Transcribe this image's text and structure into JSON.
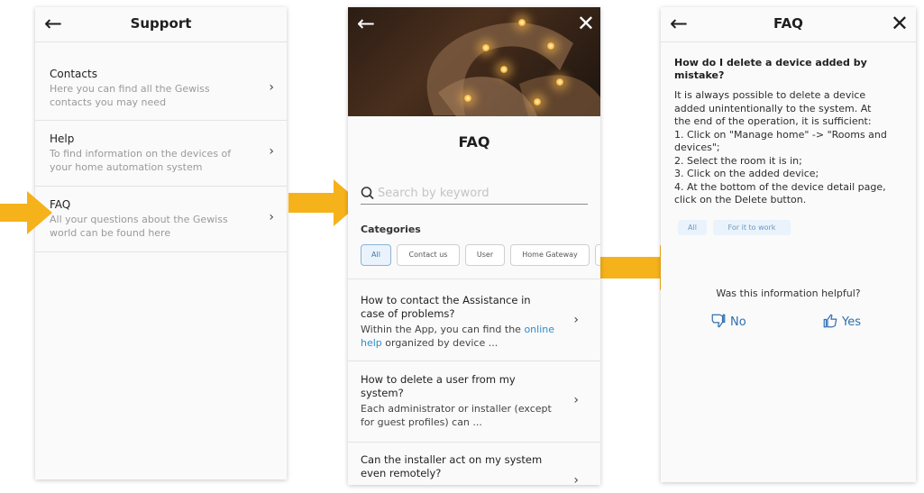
{
  "colors": {
    "accent": "#f5b21b",
    "link": "#2c8ecb",
    "chip_active": "#3b78b5"
  },
  "panel1": {
    "header": {
      "title": "Support",
      "back_icon": "arrow-left-icon"
    },
    "items": [
      {
        "title": "Contacts",
        "desc": "Here you can find all the Gewiss contacts you may need"
      },
      {
        "title": "Help",
        "desc": "To find information on the devices of your home automation system"
      },
      {
        "title": "FAQ",
        "desc": "All your questions about the Gewiss world can be found here"
      }
    ]
  },
  "panel2": {
    "title": "FAQ",
    "search": {
      "placeholder": "Search by keyword"
    },
    "categories_label": "Categories",
    "chips": [
      "All",
      "Contact us",
      "User",
      "Home Gateway"
    ],
    "questions": [
      {
        "title": "How to contact the Assistance in case of problems?",
        "answer_pre": "Within the App, you can find the ",
        "answer_link": "online help",
        "answer_post": " organized by device ..."
      },
      {
        "title": "How to delete a user from my system?",
        "answer": "Each administrator or installer (except for guest profiles) can ..."
      },
      {
        "title": "Can the installer act on my system even remotely?"
      }
    ]
  },
  "panel3": {
    "header": {
      "title": "FAQ"
    },
    "question": "How do I delete a device added by mistake?",
    "answer_lines": [
      "It is always possible to delete a device",
      "added unintentionally to the system. At",
      "the end of the operation, it is sufficient:",
      "1. Click on \"Manage home\" -> \"Rooms and",
      "devices\";",
      "2. Select the room it is in;",
      "3. Click on the added device;",
      "4. At the bottom of the device detail page,",
      "click on the Delete button."
    ],
    "tags": [
      "All",
      "For it to work"
    ],
    "helpful_text": "Was this information helpful?",
    "no_label": "No",
    "yes_label": "Yes"
  }
}
